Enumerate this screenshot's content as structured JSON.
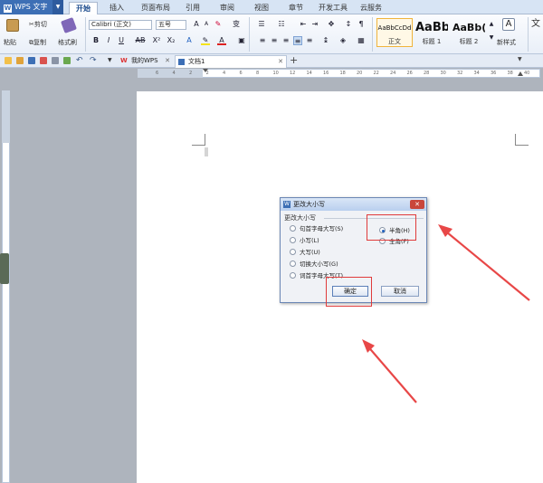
{
  "app": {
    "name": "WPS 文字",
    "logo_letter": "W"
  },
  "menu": {
    "tabs": [
      "开始",
      "插入",
      "页面布局",
      "引用",
      "审阅",
      "视图",
      "章节",
      "开发工具",
      "云服务"
    ],
    "active": "开始"
  },
  "ribbon": {
    "paste": "粘贴",
    "cut": "剪切",
    "copy": "复制",
    "format_painter": "格式刷",
    "font_name": "Calibri (正文)",
    "font_size": "五号",
    "styles": [
      {
        "sample": "AaBbCcDd",
        "name": "正文"
      },
      {
        "sample": "AaBb",
        "name": "标题 1"
      },
      {
        "sample": "AaBb(",
        "name": "标题 2"
      }
    ],
    "new_style": "新样式"
  },
  "doc_tabs": [
    {
      "label": "我的WPS"
    },
    {
      "label": "文档1"
    }
  ],
  "new_tab": "+",
  "ruler_marks": [
    "6",
    "4",
    "2",
    "2",
    "4",
    "6",
    "8",
    "10",
    "12",
    "14",
    "16",
    "18",
    "20",
    "22",
    "24",
    "26",
    "28",
    "30",
    "32",
    "34",
    "36",
    "38",
    "40"
  ],
  "dialog": {
    "title": "更改大小写",
    "group_label": "更改大小写",
    "options": [
      {
        "label": "句首字母大写(S)",
        "checked": false
      },
      {
        "label": "小写(L)",
        "checked": false
      },
      {
        "label": "大写(U)",
        "checked": false
      },
      {
        "label": "切换大小写(G)",
        "checked": false
      },
      {
        "label": "词首字母大写(T)",
        "checked": false
      }
    ],
    "width_options": [
      {
        "label": "半角(H)",
        "checked": true
      },
      {
        "label": "全角(F)",
        "checked": false
      }
    ],
    "ok": "确定",
    "cancel": "取消"
  },
  "colors": {
    "annotation": "#e03b3b",
    "brand": "#3d6fb5"
  }
}
